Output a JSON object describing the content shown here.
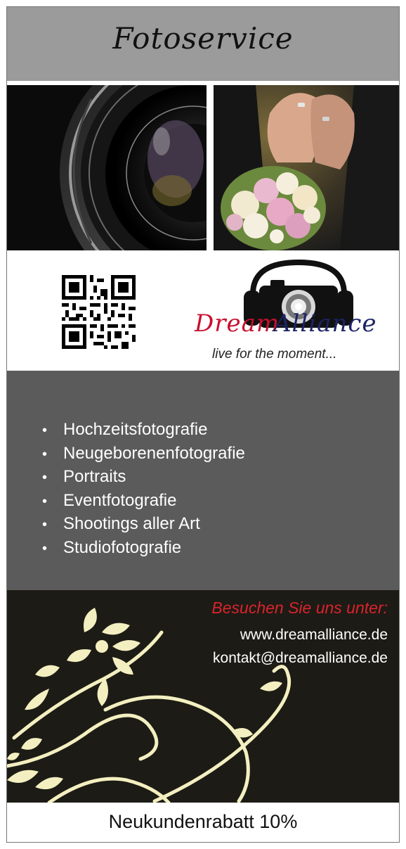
{
  "header": {
    "title": "Fotoservice"
  },
  "photos": [
    {
      "icon": "camera-lens-photo"
    },
    {
      "icon": "wedding-hands-bouquet-photo"
    }
  ],
  "brand": {
    "name_part1": "Dream",
    "name_part2": "Alliance",
    "tagline": "live for the moment..."
  },
  "services": {
    "items": [
      "Hochzeitsfotografie",
      "Neugeborenenfotografie",
      "Portraits",
      "Eventfotografie",
      "Shootings aller Art",
      "Studiofotografie"
    ]
  },
  "contact": {
    "visit_label": "Besuchen Sie uns unter:",
    "website": "www.dreamalliance.de",
    "email": "kontakt@dreamalliance.de"
  },
  "footer": {
    "discount": "Neukundenrabatt 10%"
  },
  "colors": {
    "header_bg": "#9b9b9b",
    "services_bg": "#5b5b5b",
    "contact_bg": "#1d1b15",
    "accent_red": "#d9232d",
    "flourish": "#f3efc0"
  }
}
